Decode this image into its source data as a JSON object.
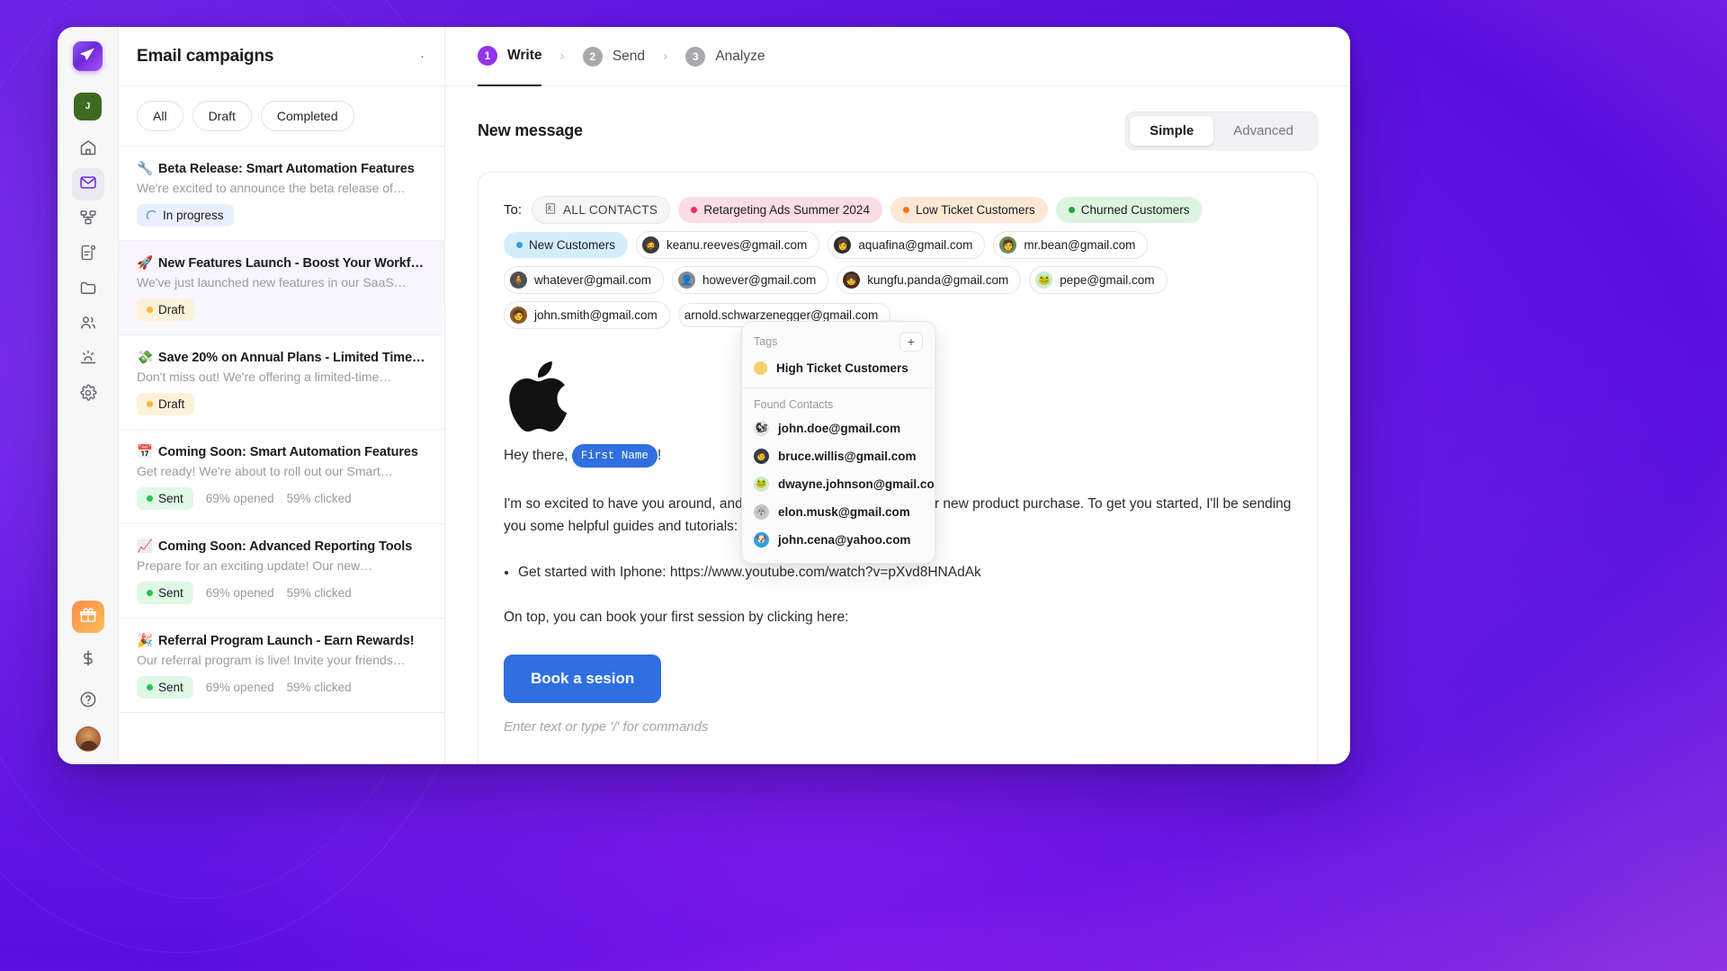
{
  "brand": {
    "accent": "#6d28d9",
    "blue": "#2f6fe0"
  },
  "rail": {
    "logo_icon": "paper-plane-icon",
    "account_initial": "J",
    "items": [
      {
        "name": "home",
        "icon": "home-icon"
      },
      {
        "name": "mail",
        "icon": "mail-icon",
        "active": true
      },
      {
        "name": "workflows",
        "icon": "nodes-icon"
      },
      {
        "name": "notifications",
        "icon": "document-alert-icon"
      },
      {
        "name": "files",
        "icon": "folder-icon"
      },
      {
        "name": "contacts",
        "icon": "people-icon"
      },
      {
        "name": "automations",
        "icon": "sunrise-icon"
      },
      {
        "name": "settings",
        "icon": "gear-icon"
      }
    ],
    "bottom": [
      {
        "name": "rewards",
        "icon": "gift-icon"
      },
      {
        "name": "billing",
        "icon": "dollar-icon"
      },
      {
        "name": "help",
        "icon": "question-circle-icon"
      },
      {
        "name": "profile",
        "icon": "avatar"
      }
    ]
  },
  "list": {
    "title": "Email campaigns",
    "filters": [
      "All",
      "Draft",
      "Completed"
    ],
    "campaigns": [
      {
        "emoji": "🔧",
        "title": "Beta Release: Smart Automation Features",
        "preview": "We're excited to announce the beta release of…",
        "status": "In progress",
        "status_kind": "progress",
        "selected": false,
        "stats": []
      },
      {
        "emoji": "🚀",
        "title": "New Features Launch - Boost Your Workflow",
        "preview": "We've just launched new features in our SaaS…",
        "status": "Draft",
        "status_kind": "draft",
        "selected": true,
        "stats": []
      },
      {
        "emoji": "💸",
        "title": "Save 20% on Annual Plans - Limited Time…",
        "preview": "Don't miss out! We're offering a limited-time…",
        "status": "Draft",
        "status_kind": "draft",
        "selected": false,
        "stats": []
      },
      {
        "emoji": "📅",
        "title": "Coming Soon: Smart Automation Features",
        "preview": "Get ready! We're about to roll out our Smart…",
        "status": "Sent",
        "status_kind": "sent",
        "selected": false,
        "stats": [
          "69% opened",
          "59% clicked"
        ]
      },
      {
        "emoji": "📈",
        "title": "Coming Soon: Advanced Reporting Tools",
        "preview": "Prepare for an exciting update! Our new…",
        "status": "Sent",
        "status_kind": "sent",
        "selected": false,
        "stats": [
          "69% opened",
          "59% clicked"
        ]
      },
      {
        "emoji": "🎉",
        "title": "Referral Program Launch - Earn Rewards!",
        "preview": "Our referral program is live! Invite your friends…",
        "status": "Sent",
        "status_kind": "sent",
        "selected": false,
        "stats": [
          "69% opened",
          "59% clicked"
        ]
      }
    ]
  },
  "steps": [
    {
      "num": "1",
      "label": "Write",
      "active": true
    },
    {
      "num": "2",
      "label": "Send",
      "active": false
    },
    {
      "num": "3",
      "label": "Analyze",
      "active": false
    }
  ],
  "main": {
    "title": "New message",
    "view_modes": [
      {
        "label": "Simple",
        "selected": true
      },
      {
        "label": "Advanced",
        "selected": false
      }
    ]
  },
  "compose": {
    "to_label": "To:",
    "tags": [
      {
        "label": "ALL CONTACTS",
        "kind": "neutral",
        "icon": "contact-card-icon"
      },
      {
        "label": "Retargeting Ads Summer 2024",
        "kind": "tag",
        "bg": "#fbdde4",
        "dot": "#ef2d56"
      },
      {
        "label": "Low Ticket Customers",
        "kind": "tag",
        "bg": "#fde8d6",
        "dot": "#f97316"
      },
      {
        "label": "Churned Customers",
        "kind": "tag",
        "bg": "#ddf5e0",
        "dot": "#22a447"
      },
      {
        "label": "New Customers",
        "kind": "tag",
        "bg": "#d4edfb",
        "dot": "#2f9fe0"
      }
    ],
    "recipients": [
      {
        "email": "keanu.reeves@gmail.com",
        "avatar_bg": "#3a3a3a",
        "avatar_glyph": "🧔"
      },
      {
        "email": "aquafina@gmail.com",
        "avatar_bg": "#2c2c2c",
        "avatar_glyph": "👩"
      },
      {
        "email": "mr.bean@gmail.com",
        "avatar_bg": "#6b8e5a",
        "avatar_glyph": "🧑"
      },
      {
        "email": "whatever@gmail.com",
        "avatar_bg": "#505050",
        "avatar_glyph": "🧍"
      },
      {
        "email": "however@gmail.com",
        "avatar_bg": "#8a8a8a",
        "avatar_glyph": "👤"
      },
      {
        "email": "kungfu.panda@gmail.com",
        "avatar_bg": "#4a2a1a",
        "avatar_glyph": "👧"
      },
      {
        "email": "pepe@gmail.com",
        "avatar_bg": "#cfe8d0",
        "avatar_glyph": "🐸"
      },
      {
        "email": "john.smith@gmail.com",
        "avatar_bg": "#8b5a2b",
        "avatar_glyph": "🧑"
      },
      {
        "email": "arnold.schwarzenegger@gmail.com",
        "avatar_bg": "#bdbdbd",
        "avatar_glyph": ""
      }
    ],
    "logo": "apple-logo",
    "greeting_prefix": "Hey there,",
    "merge_tag": "First Name",
    "greeting_suffix": "!",
    "paragraph": "I'm so excited to have you around, and I'm here to support you on your new product purchase. To get you started, I'll be sending you some helpful guides and tutorials:",
    "bullets": [
      "Get started with Iphone: https://www.youtube.com/watch?v=pXvd8HNAdAk"
    ],
    "closing": "On top, you can book your first session by clicking here:",
    "button_label": "Book a sesion",
    "editor_placeholder": "Enter text or type '/' for commands"
  },
  "dropdown": {
    "tags_header": "Tags",
    "add_label": "+",
    "tags": [
      {
        "label": "High Ticket Customers",
        "color": "#f7cf6b"
      }
    ],
    "contacts_header": "Found Contacts",
    "contacts": [
      {
        "email": "john.doe@gmail.com",
        "avatar_bg": "#e7e2dd",
        "avatar_glyph": "🐿"
      },
      {
        "email": "bruce.willis@gmail.com",
        "avatar_bg": "#2f3a4a",
        "avatar_glyph": "🧑"
      },
      {
        "email": "dwayne.johnson@gmail.com",
        "avatar_bg": "#cfe8d0",
        "avatar_glyph": "🐸"
      },
      {
        "email": "elon.musk@gmail.com",
        "avatar_bg": "#c9c9c9",
        "avatar_glyph": "🐺"
      },
      {
        "email": "john.cena@yahoo.com",
        "avatar_bg": "#2f9fe0",
        "avatar_glyph": "🐶"
      }
    ]
  }
}
